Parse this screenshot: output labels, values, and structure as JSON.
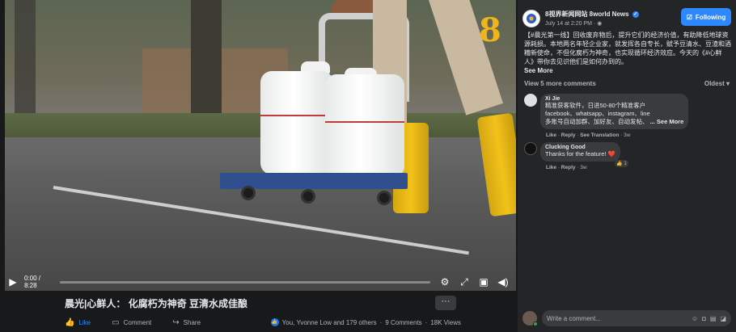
{
  "video": {
    "current_time": "0:00",
    "duration": "8:28",
    "time_display": "0:00 / 8:28",
    "progress_percent": 0,
    "title": "晨光|心鲜人： 化腐朽为神奇 豆清水成佳酿",
    "more_label": "···"
  },
  "actions": {
    "like": "Like",
    "comment": "Comment",
    "share": "Share",
    "reactions_text": "You, Yvonne Low and 179 others",
    "comments_count": "9 Comments",
    "views": "18K Views",
    "separator": "·"
  },
  "post": {
    "page_name": "8视界新闻网站 8world News",
    "verified_mark": "✓",
    "time": "July 14 at 2:20 PM",
    "privacy_icon": "globe-icon",
    "follow_label": "Following",
    "text": "【#晨光第一线】回收废弃物后，提升它们的经济价值，有助降低地球资源耗损。本地两名年轻企业家，就发挥各自专长，赋予豆清水、豆渣和酒糟新使命，不但化腐朽为神奇，也实现循环经济效应。今天的《#心鲜人》带你去见识他们是如何办到的。",
    "see_more": "See More"
  },
  "comments_bar": {
    "view_more": "View 5 more comments",
    "sort": "Oldest",
    "sort_arrow": "▾"
  },
  "comments": [
    {
      "name": "Xi Jie",
      "text": "精准获客软件，日进50-80个精准客户\nfacebook、whatsapp、instagram、line\n多账号自动加群、加好友、自动发帖、",
      "see_more": "... See More",
      "like": "Like",
      "reply": "Reply",
      "see_translation": "See Translation",
      "age": "3w"
    },
    {
      "name": "Clucking Good",
      "text": "Thanks for the feature! ❤️",
      "like": "Like",
      "reply": "Reply",
      "age": "3w",
      "reaction_count": "1"
    }
  ],
  "composer": {
    "placeholder": "Write a comment..."
  },
  "colors": {
    "background": "#18191a",
    "panel": "#242526",
    "accent": "#2d88ff",
    "bubble": "#3a3b3c",
    "logo_gold": "#f1b51c"
  },
  "icons": {
    "play": "play-icon",
    "settings": "gear-icon",
    "fullscreen": "fullscreen-icon",
    "pip": "picture-in-picture-icon",
    "volume": "volume-icon"
  }
}
